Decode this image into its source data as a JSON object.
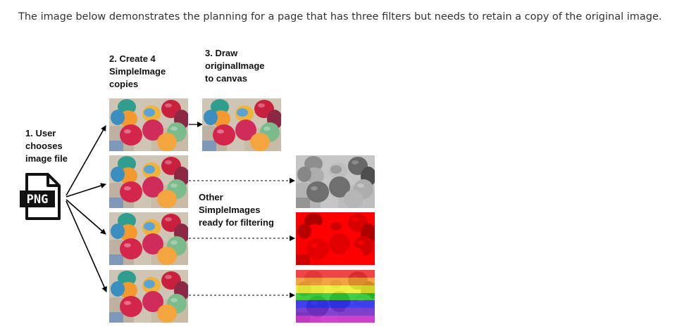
{
  "intro": "The image below demonstrates the planning for a page that has three filters but needs to retain a copy of the original image.",
  "labels": {
    "step1": "1. User\nchooses\nimage file",
    "step2": "2. Create 4\nSimpleImage\ncopies",
    "step3": "3. Draw\noriginalImage\nto canvas",
    "other": "Other\nSimpleImages\nready for filtering"
  },
  "file_icon": {
    "icon": "png-file-icon",
    "text": "PNG"
  },
  "images": {
    "copies": 4,
    "filters": [
      "grayscale",
      "red",
      "rainbow"
    ]
  },
  "colors": {
    "text": "#333333",
    "labels": "#111111",
    "arrows": "#000000"
  }
}
